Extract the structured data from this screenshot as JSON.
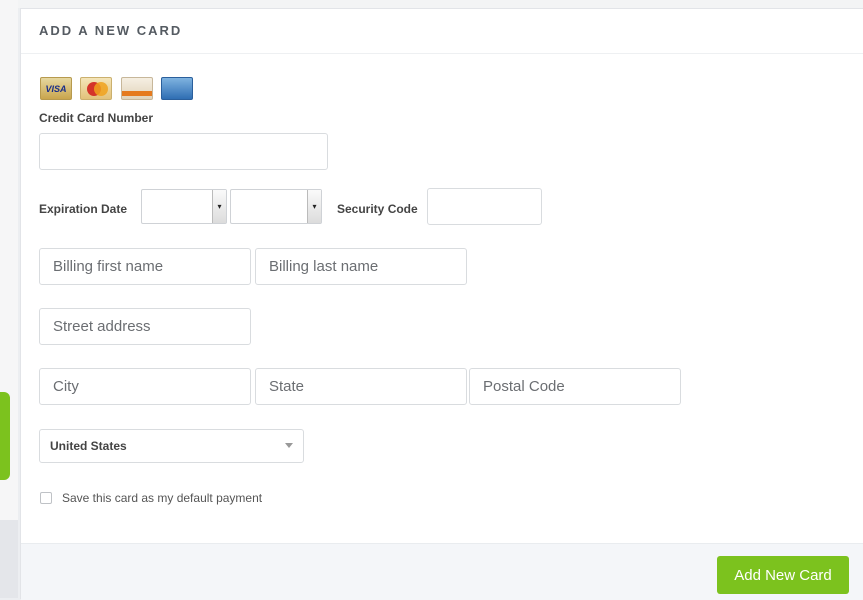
{
  "panel": {
    "title": "ADD A NEW CARD"
  },
  "card_logos": [
    "VISA",
    "MasterCard",
    "DISCOVER",
    "AMERICAN EXPRESS"
  ],
  "form": {
    "card_number_label": "Credit Card Number",
    "card_number_value": "",
    "expiration_label": "Expiration Date",
    "exp_month_value": "",
    "exp_year_value": "",
    "security_code_label": "Security Code",
    "security_code_value": "",
    "billing_first_placeholder": "Billing first name",
    "billing_last_placeholder": "Billing last name",
    "street_placeholder": "Street address",
    "city_placeholder": "City",
    "state_placeholder": "State",
    "postal_placeholder": "Postal Code",
    "country_value": "United States",
    "default_checkbox_label": "Save this card as my default payment",
    "default_checkbox_checked": false
  },
  "footer": {
    "submit_label": "Add New Card"
  },
  "colors": {
    "accent": "#7cc21e",
    "panel_bg": "#ffffff",
    "footer_bg": "#f4f6f9"
  }
}
